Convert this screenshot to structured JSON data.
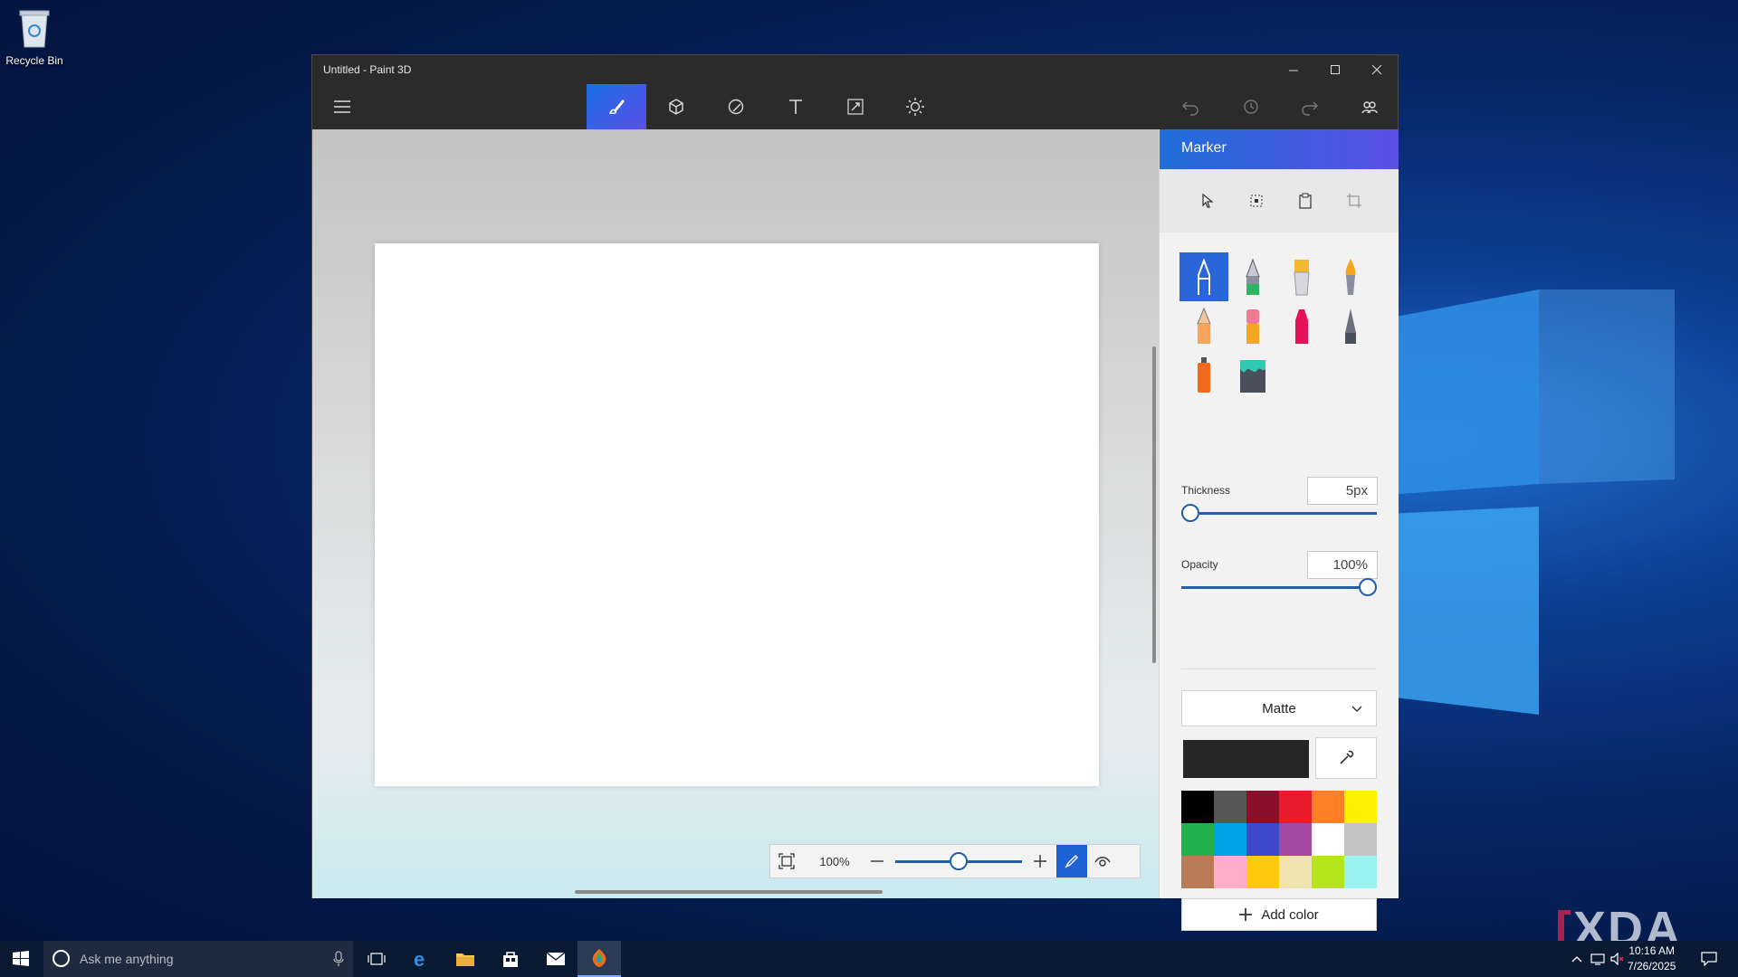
{
  "desktop": {
    "recycle_bin_label": "Recycle Bin",
    "watermark": "XDA"
  },
  "window": {
    "title": "Untitled - Paint 3D",
    "controls": [
      "minimize",
      "maximize",
      "close"
    ]
  },
  "toolbar": {
    "tools": [
      "menu-icon",
      "brushes-icon",
      "3d-shapes-icon",
      "2d-shapes-icon",
      "text-icon",
      "effects-canvas-icon",
      "effects-icon"
    ],
    "active_tool": "brushes-icon",
    "right_icons": [
      "undo-icon",
      "history-icon",
      "redo-icon",
      "community-icon"
    ]
  },
  "zoom": {
    "value_label": "100%",
    "level_fraction": 0.5
  },
  "panel": {
    "title": "Marker",
    "selection_tools": [
      "select-icon",
      "crop-select-icon",
      "paste-icon",
      "crop-icon"
    ],
    "brushes": [
      "marker",
      "calligraphy-pen",
      "oil-brush",
      "watercolor",
      "pencil",
      "eraser",
      "crayon",
      "pixel-pen",
      "spray-can",
      "fill-bucket"
    ],
    "selected_brush": "marker",
    "thickness_label": "Thickness",
    "thickness_value": "5px",
    "thickness_fraction": 0.0,
    "opacity_label": "Opacity",
    "opacity_value": "100%",
    "opacity_fraction": 1.0,
    "finish": "Matte",
    "current_color": "#262626",
    "palette": [
      "#000000",
      "#575757",
      "#8a0f2a",
      "#e81c2a",
      "#ff7f27",
      "#fff200",
      "#22b14c",
      "#00a2e8",
      "#3f48cc",
      "#a349a4",
      "#ffffff",
      "#c3c3c3",
      "#b97a57",
      "#ffaec9",
      "#ffc90e",
      "#efe4b0",
      "#b5e61d",
      "#99f3f0"
    ],
    "add_color_label": "Add color"
  },
  "taskbar": {
    "search_placeholder": "Ask me anything",
    "time": "10:16 AM",
    "date": "7/26/2025"
  },
  "colors": {
    "accent": "#1f6ed9",
    "accent2": "#5b4fe6"
  }
}
